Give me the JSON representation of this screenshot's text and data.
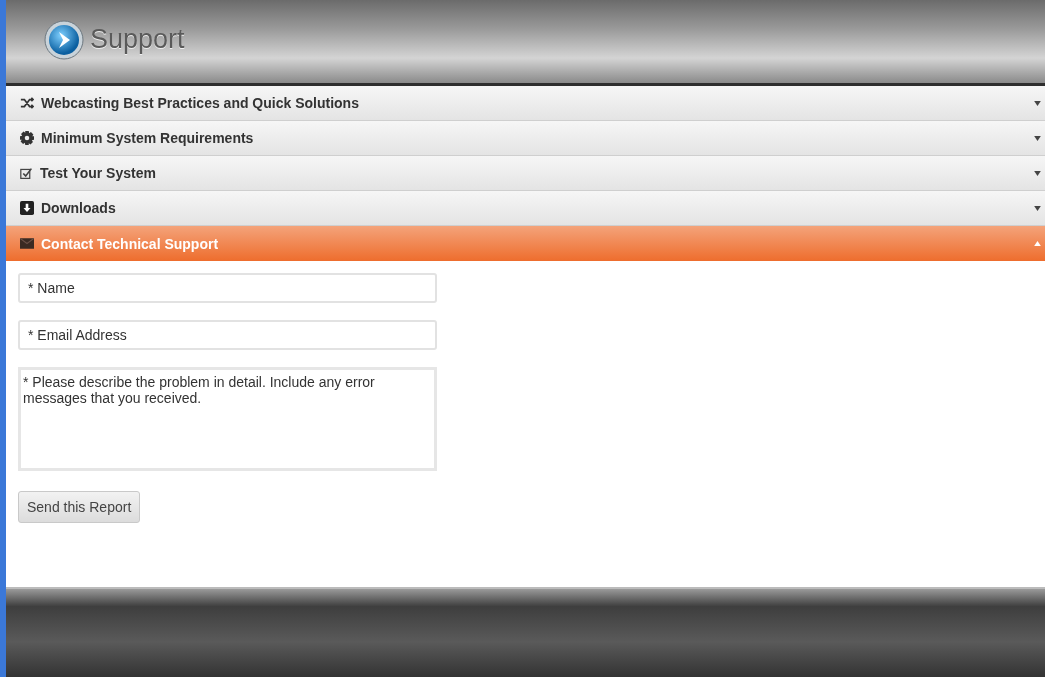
{
  "header": {
    "title": "Support"
  },
  "sections": [
    {
      "label": "Webcasting Best Practices and Quick Solutions",
      "expanded": false
    },
    {
      "label": "Minimum System Requirements",
      "expanded": false
    },
    {
      "label": "Test Your System",
      "expanded": false
    },
    {
      "label": "Downloads",
      "expanded": false
    },
    {
      "label": "Contact Technical Support",
      "expanded": true
    }
  ],
  "form": {
    "name": {
      "placeholder": "* Name"
    },
    "email": {
      "placeholder": "* Email Address"
    },
    "details": {
      "placeholder": "* Please describe the problem in detail. Include any error messages that you received."
    },
    "submit": "Send this Report"
  }
}
